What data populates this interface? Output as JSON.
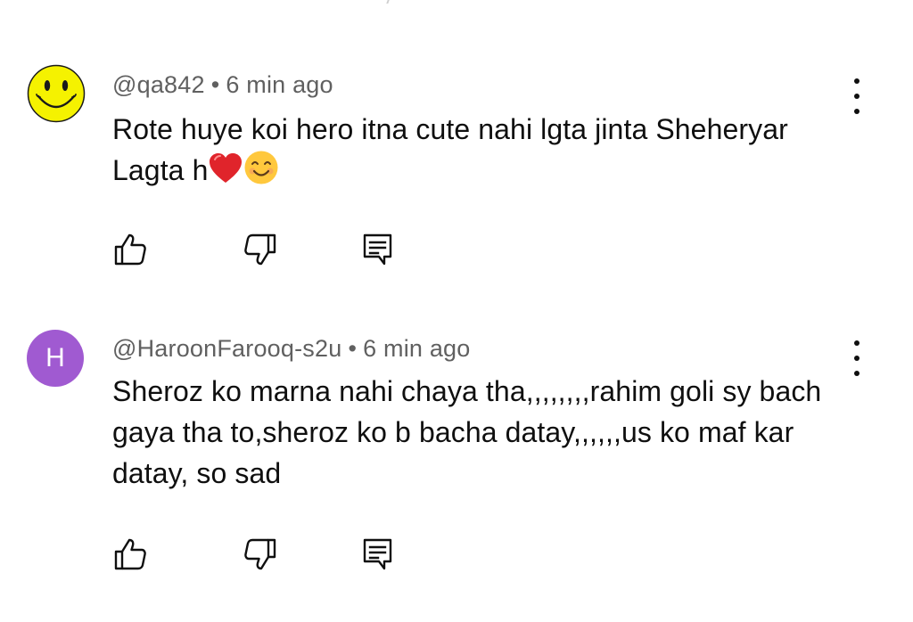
{
  "comments": [
    {
      "handle": "@qa842",
      "separator": "•",
      "time": "6 min ago",
      "text": "Rote huye koi hero itna cute nahi lgta jinta Sheheryar Lagta h",
      "emojis": [
        "red-heart",
        "smiling-face"
      ],
      "avatar": {
        "type": "image",
        "icon": "smiley-face-icon",
        "color": "#f5f200"
      }
    },
    {
      "handle": "@HaroonFarooq-s2u",
      "separator": "•",
      "time": "6 min ago",
      "text": "Sheroz ko marna nahi chaya tha,,,,,,,,rahim goli sy bach gaya tha to,sheroz ko b bacha datay,,,,,,us ko maf kar datay, so sad",
      "avatar": {
        "type": "letter",
        "letter": "H",
        "color": "#a05ad1"
      }
    }
  ],
  "actions": {
    "like_icon": "thumbs-up-icon",
    "dislike_icon": "thumbs-down-icon",
    "reply_icon": "reply-comment-icon",
    "more_icon": "more-vertical-icon"
  },
  "colors": {
    "meta_text": "#606060",
    "body_text": "#0f0f0f",
    "background": "#ffffff"
  }
}
